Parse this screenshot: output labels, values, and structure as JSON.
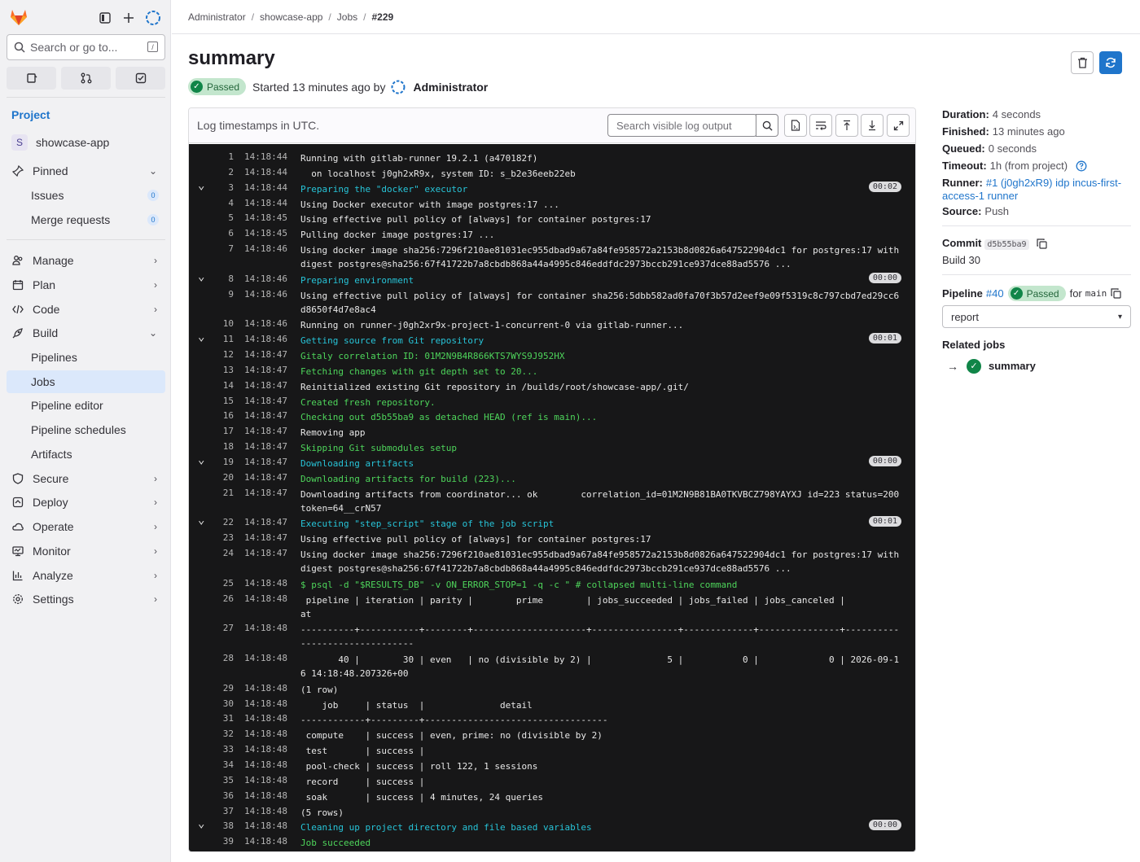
{
  "sidebar": {
    "search_placeholder": "Search or go to...",
    "kbd": "/",
    "section_title": "Project",
    "project": {
      "initial": "S",
      "name": "showcase-app"
    },
    "pinned": "Pinned",
    "issues": {
      "label": "Issues",
      "count": "0"
    },
    "merge_requests": {
      "label": "Merge requests",
      "count": "0"
    },
    "manage": "Manage",
    "plan": "Plan",
    "code": "Code",
    "build": "Build",
    "pipelines": "Pipelines",
    "jobs": "Jobs",
    "pipeline_editor": "Pipeline editor",
    "pipeline_schedules": "Pipeline schedules",
    "artifacts": "Artifacts",
    "secure": "Secure",
    "deploy": "Deploy",
    "operate": "Operate",
    "monitor": "Monitor",
    "analyze": "Analyze",
    "settings": "Settings"
  },
  "breadcrumb": [
    "Administrator",
    "showcase-app",
    "Jobs",
    "#229"
  ],
  "job": {
    "title": "summary",
    "status": "Passed",
    "started": "Started 13 minutes ago by",
    "user": "Administrator"
  },
  "log": {
    "header": "Log timestamps in UTC.",
    "search_placeholder": "Search visible log output",
    "lines": [
      {
        "n": "1",
        "t": "14:18:44",
        "x": "Running with gitlab-runner 19.2.1 (a470182f)",
        "c": ""
      },
      {
        "n": "2",
        "t": "14:18:44",
        "x": "  on localhost j0gh2xR9x, system ID: s_b2e36eeb22eb",
        "c": ""
      },
      {
        "n": "3",
        "t": "14:18:44",
        "x": "Preparing the \"docker\" executor",
        "c": "cyan",
        "toggle": true,
        "dur": "00:02"
      },
      {
        "n": "4",
        "t": "14:18:44",
        "x": "Using Docker executor with image postgres:17 ...",
        "c": ""
      },
      {
        "n": "5",
        "t": "14:18:45",
        "x": "Using effective pull policy of [always] for container postgres:17",
        "c": ""
      },
      {
        "n": "6",
        "t": "14:18:45",
        "x": "Pulling docker image postgres:17 ...",
        "c": ""
      },
      {
        "n": "7",
        "t": "14:18:46",
        "x": "Using docker image sha256:7296f210ae81031ec955dbad9a67a84fe958572a2153b8d0826a647522904dc1 for postgres:17 with digest postgres@sha256:67f41722b7a8cbdb868a44a4995c846eddfdc2973bccb291ce937dce88ad5576 ...",
        "c": "",
        "h": 2
      },
      {
        "n": "8",
        "t": "14:18:46",
        "x": "Preparing environment",
        "c": "cyan",
        "toggle": true,
        "dur": "00:00"
      },
      {
        "n": "9",
        "t": "14:18:46",
        "x": "Using effective pull policy of [always] for container sha256:5dbb582ad0fa70f3b57d2eef9e09f5319c8c797cbd7ed29cc6d8650f4d7e8ac4",
        "c": "",
        "h": 2
      },
      {
        "n": "10",
        "t": "14:18:46",
        "x": "Running on runner-j0gh2xr9x-project-1-concurrent-0 via gitlab-runner...",
        "c": ""
      },
      {
        "n": "11",
        "t": "14:18:46",
        "x": "Getting source from Git repository",
        "c": "cyan",
        "toggle": true,
        "dur": "00:01"
      },
      {
        "n": "12",
        "t": "14:18:47",
        "x": "Gitaly correlation ID: 01M2N9B4R866KTS7WYS9J952HX",
        "c": "green"
      },
      {
        "n": "13",
        "t": "14:18:47",
        "x": "Fetching changes with git depth set to 20...",
        "c": "green"
      },
      {
        "n": "14",
        "t": "14:18:47",
        "x": "Reinitialized existing Git repository in /builds/root/showcase-app/.git/",
        "c": ""
      },
      {
        "n": "15",
        "t": "14:18:47",
        "x": "Created fresh repository.",
        "c": "green"
      },
      {
        "n": "16",
        "t": "14:18:47",
        "x": "Checking out d5b55ba9 as detached HEAD (ref is main)...",
        "c": "green"
      },
      {
        "n": "17",
        "t": "14:18:47",
        "x": "Removing app",
        "c": ""
      },
      {
        "n": "18",
        "t": "14:18:47",
        "x": "Skipping Git submodules setup",
        "c": "green"
      },
      {
        "n": "19",
        "t": "14:18:47",
        "x": "Downloading artifacts",
        "c": "cyan",
        "toggle": true,
        "dur": "00:00"
      },
      {
        "n": "20",
        "t": "14:18:47",
        "x": "Downloading artifacts for build (223)...",
        "c": "green"
      },
      {
        "n": "21",
        "t": "14:18:47",
        "x": "Downloading artifacts from coordinator... ok        correlation_id=01M2N9B81BA0TKVBCZ798YAYXJ id=223 status=200 token=64__crN57",
        "c": "",
        "h": 2
      },
      {
        "n": "22",
        "t": "14:18:47",
        "x": "Executing \"step_script\" stage of the job script",
        "c": "cyan",
        "toggle": true,
        "dur": "00:01"
      },
      {
        "n": "23",
        "t": "14:18:47",
        "x": "Using effective pull policy of [always] for container postgres:17",
        "c": ""
      },
      {
        "n": "24",
        "t": "14:18:47",
        "x": "Using docker image sha256:7296f210ae81031ec955dbad9a67a84fe958572a2153b8d0826a647522904dc1 for postgres:17 with digest postgres@sha256:67f41722b7a8cbdb868a44a4995c846eddfdc2973bccb291ce937dce88ad5576 ...",
        "c": "",
        "h": 2
      },
      {
        "n": "25",
        "t": "14:18:48",
        "x": "$ psql -d \"$RESULTS_DB\" -v ON_ERROR_STOP=1 -q -c \" # collapsed multi-line command",
        "c": "green"
      },
      {
        "n": "26",
        "t": "14:18:48",
        "x": " pipeline | iteration | parity |        prime        | jobs_succeeded | jobs_failed | jobs_canceled |          at",
        "c": "",
        "h": 2
      },
      {
        "n": "27",
        "t": "14:18:48",
        "x": "----------+-----------+--------+---------------------+----------------+-------------+---------------+-------------------------------",
        "c": "",
        "h": 2
      },
      {
        "n": "28",
        "t": "14:18:48",
        "x": "       40 |        30 | even   | no (divisible by 2) |              5 |           0 |             0 | 2026-09-16 14:18:48.207326+00",
        "c": "",
        "h": 2
      },
      {
        "n": "29",
        "t": "14:18:48",
        "x": "(1 row)",
        "c": ""
      },
      {
        "n": "30",
        "t": "14:18:48",
        "x": "    job     | status  |              detail",
        "c": ""
      },
      {
        "n": "31",
        "t": "14:18:48",
        "x": "------------+---------+----------------------------------",
        "c": ""
      },
      {
        "n": "32",
        "t": "14:18:48",
        "x": " compute    | success | even, prime: no (divisible by 2)",
        "c": ""
      },
      {
        "n": "33",
        "t": "14:18:48",
        "x": " test       | success |",
        "c": ""
      },
      {
        "n": "34",
        "t": "14:18:48",
        "x": " pool-check | success | roll 122, 1 sessions",
        "c": ""
      },
      {
        "n": "35",
        "t": "14:18:48",
        "x": " record     | success |",
        "c": ""
      },
      {
        "n": "36",
        "t": "14:18:48",
        "x": " soak       | success | 4 minutes, 24 queries",
        "c": ""
      },
      {
        "n": "37",
        "t": "14:18:48",
        "x": "(5 rows)",
        "c": ""
      },
      {
        "n": "38",
        "t": "14:18:48",
        "x": "Cleaning up project directory and file based variables",
        "c": "cyan",
        "toggle": true,
        "dur": "00:00"
      },
      {
        "n": "39",
        "t": "14:18:48",
        "x": "Job succeeded",
        "c": "green"
      }
    ]
  },
  "details": {
    "duration_label": "Duration:",
    "duration": "4 seconds",
    "finished_label": "Finished:",
    "finished": "13 minutes ago",
    "queued_label": "Queued:",
    "queued": "0 seconds",
    "timeout_label": "Timeout:",
    "timeout": "1h (from project)",
    "runner_label": "Runner:",
    "runner": "#1 (j0gh2xR9) idp incus-first-access-1 runner",
    "source_label": "Source:",
    "source": "Push",
    "commit_label": "Commit",
    "commit_sha": "d5b55ba9",
    "commit_title": "Build 30",
    "pipeline_label": "Pipeline",
    "pipeline_id": "#40",
    "pipeline_status": "Passed",
    "pipeline_for": "for",
    "pipeline_ref": "main",
    "stage_select": "report",
    "related_jobs_label": "Related jobs",
    "related_job": "summary"
  },
  "colors": {
    "accent": "#1f75cb",
    "success": "#108548",
    "log_bg": "#171718",
    "log_cyan": "#27c4d8",
    "log_green": "#4ed55b"
  }
}
